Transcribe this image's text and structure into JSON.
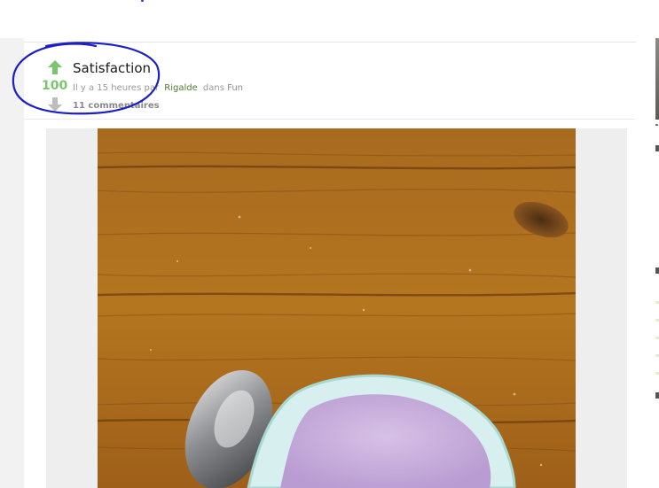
{
  "post": {
    "title": "Satisfaction",
    "score": "100",
    "meta_prefix": "Il y a 15 heures par",
    "author": "Rigalde",
    "meta_in": "dans",
    "category": "Fun",
    "comments": "11 commentaires"
  },
  "icons": {
    "upvote": "arrow-up-icon",
    "downvote": "arrow-down-icon"
  },
  "colors": {
    "upvote": "#7cc56f",
    "downvote": "#bdbdbd",
    "annotation": "#1c1fc4",
    "author": "#4f7a2e"
  },
  "image": {
    "subject": "photo of an open pink yogurt cup and a spoon on a wooden table"
  }
}
